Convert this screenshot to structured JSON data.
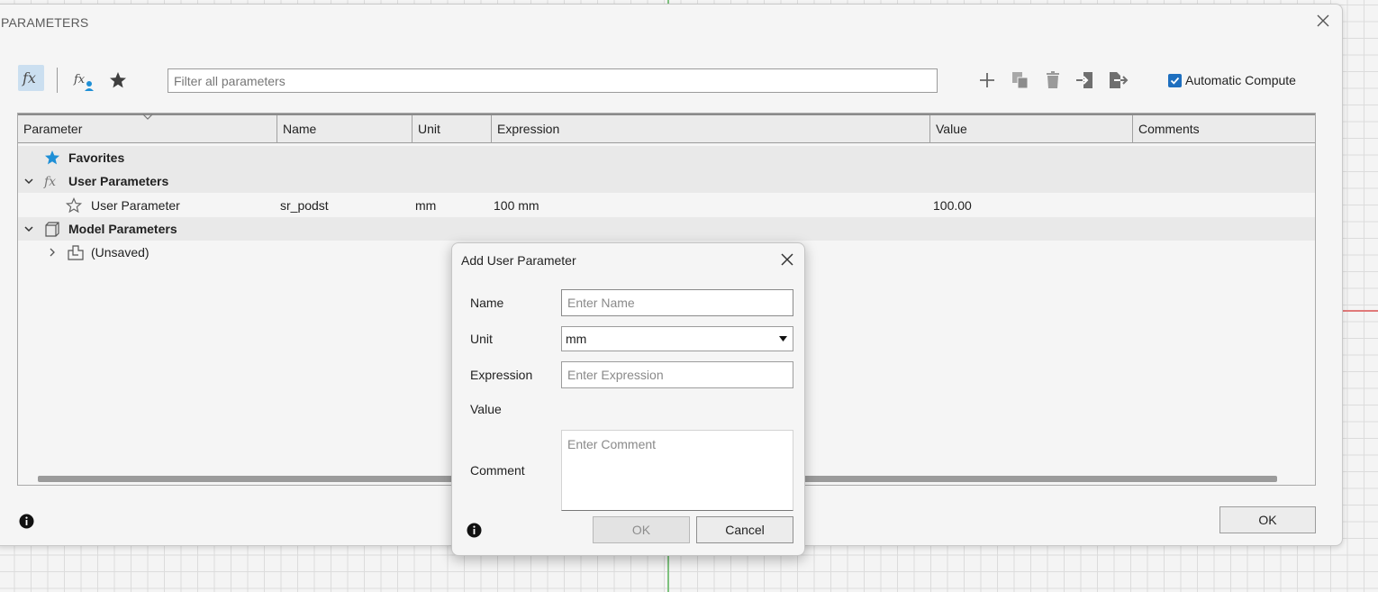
{
  "window": {
    "title": "PARAMETERS",
    "filter_placeholder": "Filter all parameters",
    "automatic_compute_label": "Automatic Compute",
    "automatic_compute_checked": true,
    "ok_label": "OK"
  },
  "table": {
    "columns": [
      "Parameter",
      "Name",
      "Unit",
      "Expression",
      "Value",
      "Comments"
    ],
    "rows": {
      "favorites": {
        "label": "Favorites"
      },
      "user_group": {
        "label": "User Parameters"
      },
      "user_param": {
        "parameter": "User Parameter",
        "name": "sr_podst",
        "unit": "mm",
        "expression": "100 mm",
        "value": "100.00",
        "comments": ""
      },
      "model_group": {
        "label": "Model Parameters"
      },
      "unsaved": {
        "label": "(Unsaved)"
      }
    }
  },
  "dialog": {
    "title": "Add User Parameter",
    "name_label": "Name",
    "name_placeholder": "Enter Name",
    "unit_label": "Unit",
    "unit_value": "mm",
    "expression_label": "Expression",
    "expression_placeholder": "Enter Expression",
    "value_label": "Value",
    "comment_label": "Comment",
    "comment_placeholder": "Enter Comment",
    "ok_label": "OK",
    "cancel_label": "Cancel"
  },
  "colors": {
    "accent": "#1e6fbf",
    "fx_button_bg": "#cbdff0",
    "favorite_star": "#1e8fd6"
  },
  "icons": [
    "close-icon",
    "fx-icon",
    "fx-user-icon",
    "star-icon",
    "add-icon",
    "copy-icon",
    "delete-icon",
    "import-icon",
    "export-icon",
    "checkbox-checked-icon",
    "chevron-down-icon",
    "chevron-right-icon",
    "component-icon",
    "model-box-icon",
    "info-icon",
    "dropdown-arrow-icon"
  ]
}
